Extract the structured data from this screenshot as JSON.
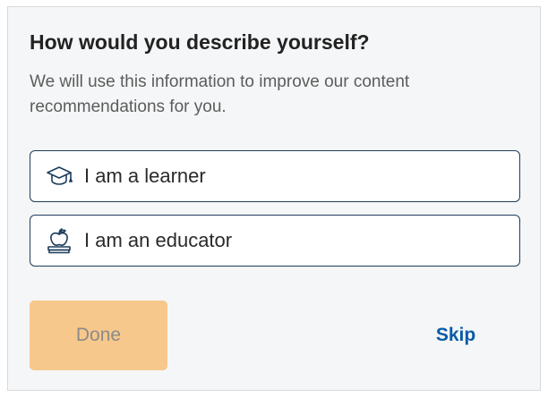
{
  "dialog": {
    "title": "How would you describe yourself?",
    "subtitle": "We will use this information to improve our content recommendations for you."
  },
  "options": [
    {
      "label": "I am a learner",
      "icon": "graduation-cap-icon"
    },
    {
      "label": "I am an educator",
      "icon": "apple-on-books-icon"
    }
  ],
  "actions": {
    "done_label": "Done",
    "done_state": "disabled",
    "skip_label": "Skip"
  },
  "colors": {
    "background": "#f5f6f7",
    "option_border": "#1d3d5c",
    "done_bg": "#f7c88b",
    "skip_text": "#0a5aa8"
  }
}
